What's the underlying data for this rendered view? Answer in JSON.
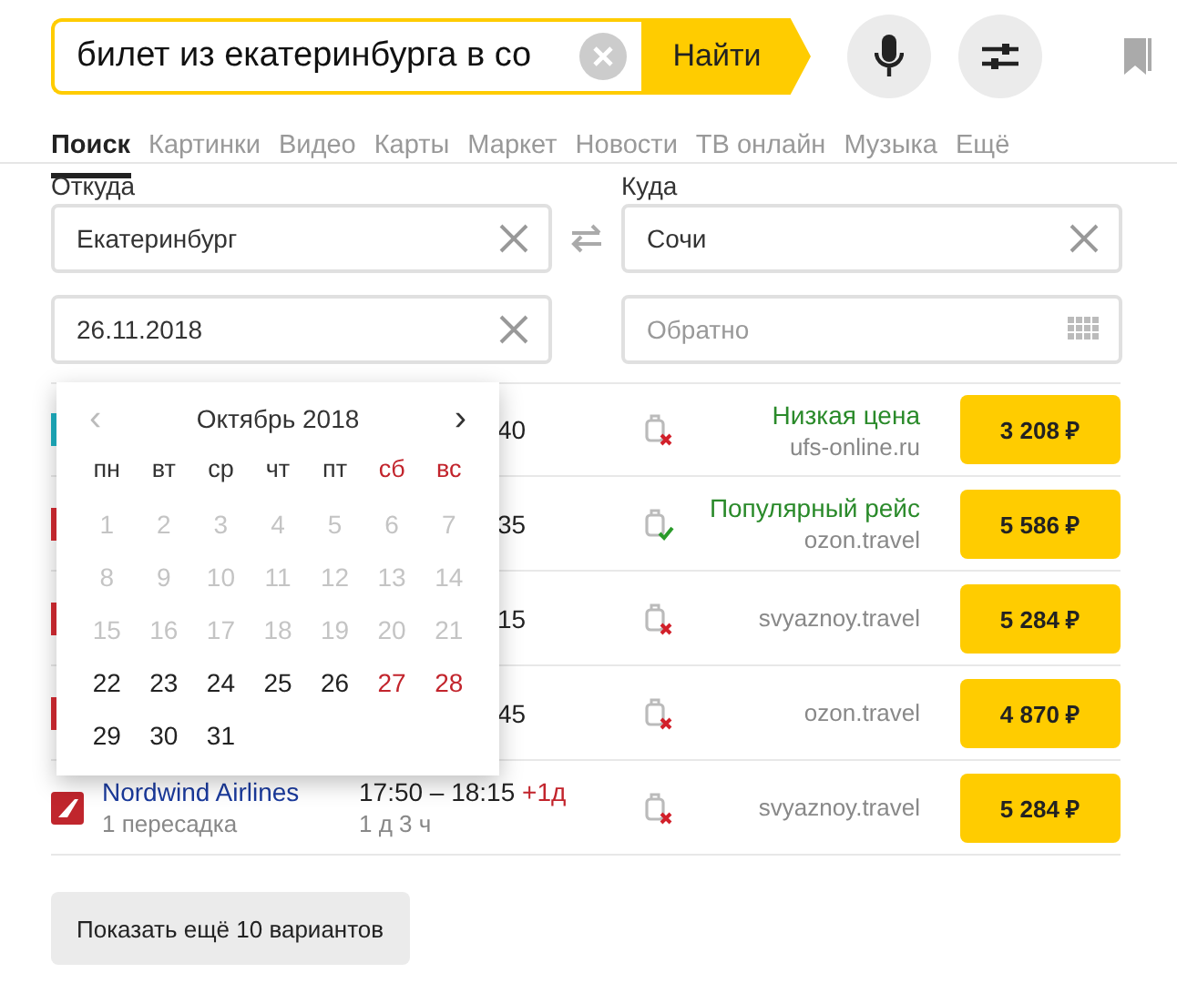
{
  "search": {
    "query": "билет из екатеринбурга в со",
    "button": "Найти"
  },
  "tabs": [
    {
      "label": "Поиск",
      "selected": true
    },
    {
      "label": "Картинки",
      "selected": false
    },
    {
      "label": "Видео",
      "selected": false
    },
    {
      "label": "Карты",
      "selected": false
    },
    {
      "label": "Маркет",
      "selected": false
    },
    {
      "label": "Новости",
      "selected": false
    },
    {
      "label": "ТВ онлайн",
      "selected": false
    },
    {
      "label": "Музыка",
      "selected": false
    },
    {
      "label": "Ещё",
      "selected": false
    }
  ],
  "form": {
    "from_label": "Откуда",
    "from": "Екатеринбург",
    "to_label": "Куда",
    "to": "Сочи",
    "date": "26.11.2018",
    "return_placeholder": "Обратно"
  },
  "calendar": {
    "title": "Октябрь 2018",
    "prev": "‹",
    "next": "›",
    "weekdays": [
      {
        "label": "пн",
        "weekend": false
      },
      {
        "label": "вт",
        "weekend": false
      },
      {
        "label": "ср",
        "weekend": false
      },
      {
        "label": "чт",
        "weekend": false
      },
      {
        "label": "пт",
        "weekend": false
      },
      {
        "label": "сб",
        "weekend": true
      },
      {
        "label": "вс",
        "weekend": true
      }
    ],
    "days": [
      {
        "label": "1",
        "disabled": true
      },
      {
        "label": "2",
        "disabled": true
      },
      {
        "label": "3",
        "disabled": true
      },
      {
        "label": "4",
        "disabled": true
      },
      {
        "label": "5",
        "disabled": true
      },
      {
        "label": "6",
        "disabled": true
      },
      {
        "label": "7",
        "disabled": true
      },
      {
        "label": "8",
        "disabled": true
      },
      {
        "label": "9",
        "disabled": true
      },
      {
        "label": "10",
        "disabled": true
      },
      {
        "label": "11",
        "disabled": true
      },
      {
        "label": "12",
        "disabled": true
      },
      {
        "label": "13",
        "disabled": true
      },
      {
        "label": "14",
        "disabled": true
      },
      {
        "label": "15",
        "disabled": true
      },
      {
        "label": "16",
        "disabled": true
      },
      {
        "label": "17",
        "disabled": true
      },
      {
        "label": "18",
        "disabled": true
      },
      {
        "label": "19",
        "disabled": true
      },
      {
        "label": "20",
        "disabled": true
      },
      {
        "label": "21",
        "disabled": true
      },
      {
        "label": "22",
        "disabled": false,
        "weekend": false
      },
      {
        "label": "23",
        "disabled": false,
        "weekend": false
      },
      {
        "label": "24",
        "disabled": false,
        "weekend": false
      },
      {
        "label": "25",
        "disabled": false,
        "weekend": false
      },
      {
        "label": "26",
        "disabled": false,
        "weekend": false
      },
      {
        "label": "27",
        "disabled": false,
        "weekend": true
      },
      {
        "label": "28",
        "disabled": false,
        "weekend": true
      },
      {
        "label": "29",
        "disabled": false,
        "weekend": false
      },
      {
        "label": "30",
        "disabled": false,
        "weekend": false
      },
      {
        "label": "31",
        "disabled": false,
        "weekend": false
      }
    ]
  },
  "flights": [
    {
      "color": "#1aa0b0",
      "time": "40",
      "baggage": false,
      "tag": "Низкая цена",
      "site": "ufs-online.ru",
      "price": "3 208 ₽"
    },
    {
      "color": "#c0262d",
      "time": "35",
      "baggage": true,
      "tag": "Популярный рейс",
      "site": "ozon.travel",
      "price": "5 586 ₽"
    },
    {
      "color": "#c0262d",
      "time": "15",
      "baggage": false,
      "site": "svyaznoy.travel",
      "price": "5 284 ₽"
    },
    {
      "color": "#c0262d",
      "time": "45",
      "baggage": false,
      "site": "ozon.travel",
      "price": "4 870 ₽"
    },
    {
      "color": "#c0262d",
      "airline": "Nordwind Airlines",
      "stops": "1 пересадка",
      "time": "17:50 – 18:15",
      "next_day": "+1д",
      "duration": "1 д 3 ч",
      "baggage": false,
      "site": "svyaznoy.travel",
      "price": "5 284 ₽"
    }
  ],
  "more_button": "Показать ещё 10 вариантов"
}
